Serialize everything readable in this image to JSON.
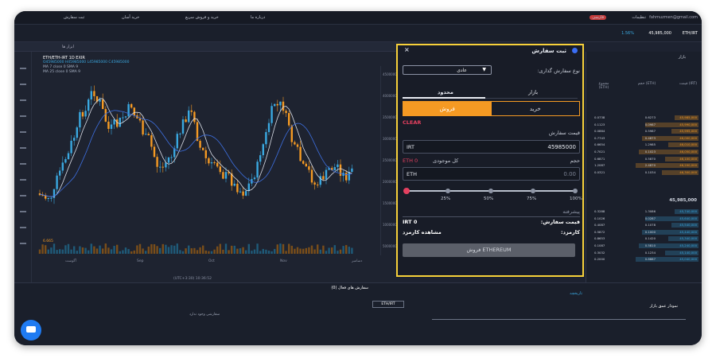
{
  "topnav": {
    "items": [
      "تنظیمات",
      "درباره ما",
      "خرید و فروش سریع",
      "خرید آسان",
      "ثبت سفارش"
    ],
    "language": "فارسی",
    "email": "fahmuzmen@gmail.com"
  },
  "subnav": {
    "pair": "ETH/IRT",
    "price": "45,985,000",
    "change": "1.56%"
  },
  "tabbar": {
    "tab": "ابزار ها"
  },
  "chart": {
    "symbol": "ETH/ETH-IRT",
    "interval": "1D",
    "exchange": "EXIR",
    "ohlc": "O45985000 H45985000 L45985000 C45985000",
    "ma1": "MA 7 close 0 SMA 9",
    "ma2": "MA 25 close 0 SMA 9",
    "volume": "6.665",
    "price_axis": [
      "45000000",
      "40000000",
      "35000000",
      "30000000",
      "25000000",
      "20000000",
      "15000000",
      "10000000",
      "5000000"
    ],
    "x_axis": [
      "آگوست",
      "Sep",
      "Oct",
      "Nov",
      "دسامبر"
    ],
    "footer": "(UTC+3:30) 10:36:52"
  },
  "orderbook": {
    "title": "بازار",
    "col_price": "قیمت (IRT)",
    "col_amount": "حجم (ETH)",
    "col_total": "مجموع (ETH)",
    "mid_price": "45,985,000",
    "asks": [
      [
        "45,985,000",
        "0.6273",
        "0.0738"
      ],
      [
        "45,990,000",
        "0.0987",
        "0.1123"
      ],
      [
        "45,995,000",
        "0.5987",
        "0.0864"
      ],
      [
        "46,000,000",
        "0.4873",
        "0.7743"
      ],
      [
        "46,010,000",
        "1.2985",
        "0.6654"
      ],
      [
        "46,050,000",
        "0.1023",
        "0.7021"
      ],
      [
        "46,100,000",
        "0.5870",
        "0.6871"
      ],
      [
        "46,200,000",
        "2.4870",
        "1.2087"
      ],
      [
        "46,300,000",
        "0.1034",
        "0.0321"
      ]
    ],
    "bids": [
      [
        "45,740,000",
        "1.3086",
        "0.3288"
      ],
      [
        "45,640,000",
        "0.0287",
        "0.1026"
      ],
      [
        "45,540,000",
        "0.1078",
        "0.4087"
      ],
      [
        "45,440,000",
        "0.1000",
        "0.5872"
      ],
      [
        "45,340,000",
        "0.1420",
        "0.8653"
      ],
      [
        "45,240,000",
        "0.5810",
        "0.1087"
      ],
      [
        "45,140,000",
        "0.1234",
        "0.3032"
      ],
      [
        "45,040,000",
        "0.8887",
        "0.2000"
      ]
    ]
  },
  "order_panel": {
    "title": "ثبت سفارش",
    "order_type_label": "نوع سفارش گذاری:",
    "order_type_value": "عادی",
    "tab_market": "بازار",
    "tab_limit": "محدود",
    "side_buy": "خرید",
    "side_sell": "فروش",
    "clear": "CLEAR",
    "price_label": "قیمت سفارش",
    "price_value": "45985000",
    "price_unit": "IRT",
    "amount_label": "حجم",
    "balance_label": "کل موجودی",
    "balance_value": "ETH 0",
    "amount_value": "0.00",
    "amount_unit": "ETH",
    "slider_marks": [
      "100%",
      "75%",
      "50%",
      "25%"
    ],
    "advanced_label": "پیشرفته",
    "total_label": "قیمت سفارش:",
    "total_value": "IRT 0",
    "fee_label": "کارمزد:",
    "fee_link": "مشاهده کارمزد",
    "submit": "فروش ETHEREUM"
  },
  "bottom": {
    "left_title": "سفارش های فعال (0)",
    "left_filter": "ETH/IRT",
    "left_empty": "سفارشی وجود ندارد",
    "right_title": "نمودار عمق بازار",
    "trade_link": "تاریخچه"
  },
  "colors": {
    "accent": "#f59a23",
    "frame_border": "#f7d13a",
    "up": "#3aa8e0",
    "down": "#f59a23",
    "clear": "#e4405f"
  }
}
